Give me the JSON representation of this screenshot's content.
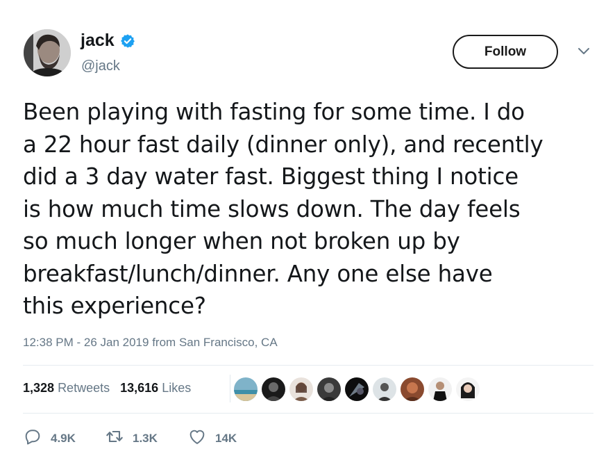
{
  "user": {
    "name": "jack",
    "handle": "@jack",
    "verified": true
  },
  "follow_label": "Follow",
  "tweet_lines": [
    "Been playing with fasting for some time. I do",
    "a 22 hour fast daily (dinner only), and recently",
    "did a 3 day water fast. Biggest thing I notice",
    "is how much time slows down. The day feels",
    "so much longer when not broken up by",
    "breakfast/lunch/dinner. Any one else have",
    "this experience?"
  ],
  "meta": {
    "timestamp": "12:38 PM - 26 Jan 2019",
    "from_label": "from",
    "location": "San Francisco, CA"
  },
  "stats": {
    "retweets_count": "1,328",
    "retweets_label": "Retweets",
    "likes_count": "13,616",
    "likes_label": "Likes"
  },
  "liker_avatars_count": 9,
  "actions": {
    "replies": "4.9K",
    "retweets": "1.3K",
    "likes": "14K"
  },
  "colors": {
    "verified": "#1da1f2",
    "secondary_text": "#657786",
    "primary_text": "#14171a"
  },
  "icons": [
    "verified-badge-icon",
    "chevron-down-icon",
    "reply-icon",
    "retweet-icon",
    "heart-icon"
  ]
}
